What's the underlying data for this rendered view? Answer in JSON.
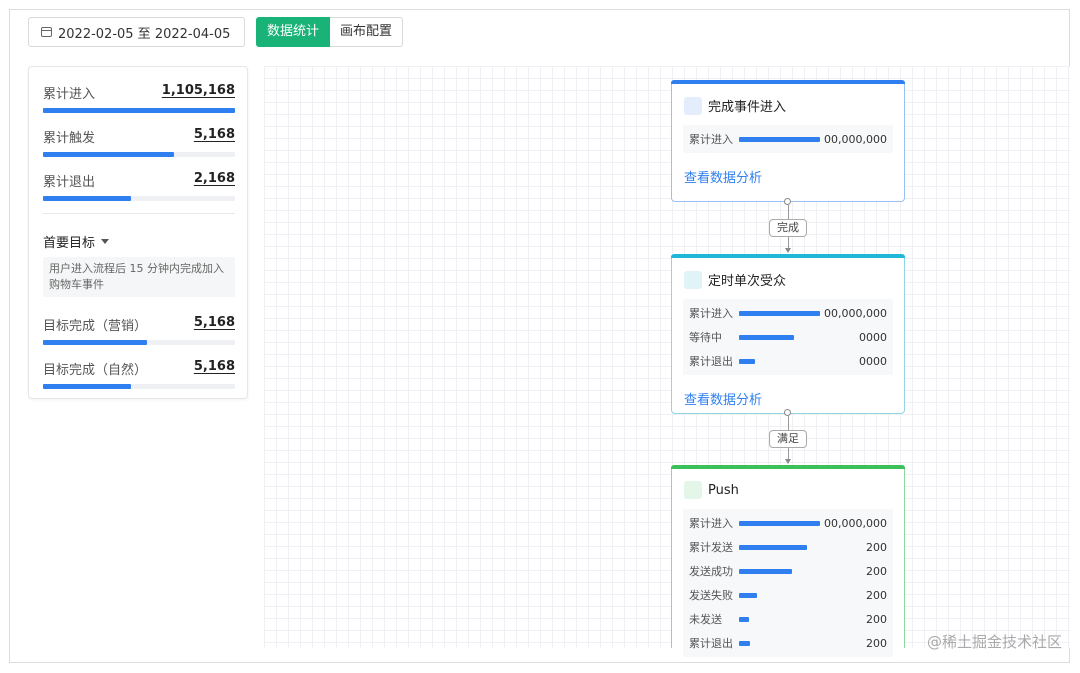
{
  "toolbar": {
    "date_range": "2022-02-05 至 2022-04-05",
    "tabs": [
      {
        "label": "数据统计",
        "active": true
      },
      {
        "label": "画布配置",
        "active": false
      }
    ]
  },
  "stats_panel": {
    "metrics": [
      {
        "label": "累计进入",
        "value": "1,105,168",
        "fill": 1.0
      },
      {
        "label": "累计触发",
        "value": "5,168",
        "fill": 0.68
      },
      {
        "label": "累计退出",
        "value": "2,168",
        "fill": 0.46
      }
    ],
    "goal_title": "首要目标",
    "goal_desc": "用户进入流程后 15 分钟内完成加入购物车事件",
    "goal_metrics": [
      {
        "label": "目标完成（营销）",
        "value": "5,168",
        "fill": 0.54
      },
      {
        "label": "目标完成（自然）",
        "value": "5,168",
        "fill": 0.46
      }
    ]
  },
  "nodes": [
    {
      "title": "完成事件进入",
      "accent": "#2f7ff0",
      "icon_color": "#e3edfc",
      "metrics": [
        {
          "label": "累计进入",
          "value": "00,000,000",
          "fill": 1.0
        }
      ],
      "link": "查看数据分析"
    },
    {
      "title": "定时单次受众",
      "accent": "#1fb8d6",
      "icon_color": "#e0f4f8",
      "metrics": [
        {
          "label": "累计进入",
          "value": "00,000,000",
          "fill": 1.0
        },
        {
          "label": "等待中",
          "value": "0000",
          "fill": 0.68
        },
        {
          "label": "累计退出",
          "value": "0000",
          "fill": 0.2
        }
      ],
      "link": "查看数据分析"
    },
    {
      "title": "Push",
      "accent": "#3cc05a",
      "icon_color": "#e4f6e8",
      "metrics": [
        {
          "label": "累计进入",
          "value": "00,000,000",
          "fill": 1.0
        },
        {
          "label": "累计发送",
          "value": "200",
          "fill": 0.84
        },
        {
          "label": "发送成功",
          "value": "200",
          "fill": 0.65
        },
        {
          "label": "发送失败",
          "value": "200",
          "fill": 0.22
        },
        {
          "label": "未发送",
          "value": "200",
          "fill": 0.12
        },
        {
          "label": "累计退出",
          "value": "200",
          "fill": 0.14
        }
      ]
    }
  ],
  "connectors": [
    {
      "label": "完成"
    },
    {
      "label": "满足"
    }
  ],
  "watermark": "@稀土掘金技术社区"
}
